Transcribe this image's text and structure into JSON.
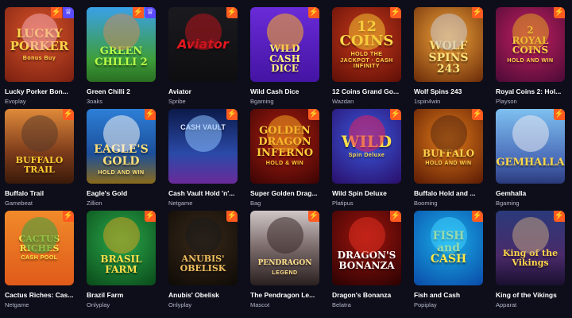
{
  "games": [
    {
      "title": "Lucky Porker Bon...",
      "provider": "Evoplay",
      "art": "LUCKY\nPORKER",
      "art_sub": "Bonus Buy",
      "theme": "t-lucky",
      "figure": "#f6a7b0",
      "badges": [
        "hot",
        "trophy"
      ]
    },
    {
      "title": "Green Chilli 2",
      "provider": "3oaks",
      "art": "GREEN\nCHILLI 2",
      "art_sub": "",
      "theme": "t-chilli",
      "figure": "#c98a5a",
      "badges": [
        "hot",
        "trophy"
      ]
    },
    {
      "title": "Aviator",
      "provider": "Spribe",
      "art": "Aviator",
      "art_sub": "",
      "theme": "t-aviator",
      "figure": "#b8141c",
      "badges": [
        "hot"
      ]
    },
    {
      "title": "Wild Cash Dice",
      "provider": "Bgaming",
      "art": "WILD CASH\nDICE",
      "art_sub": "",
      "theme": "t-wildcash",
      "figure": "#ffb020",
      "badges": [
        "hot"
      ]
    },
    {
      "title": "12 Coins Grand Go...",
      "provider": "Wazdan",
      "art": "12\nCOINS",
      "art_sub": "HOLD THE JACKPOT · CASH INFINITY",
      "theme": "t-coins12",
      "figure": "#f0c030",
      "badges": [
        "hot"
      ]
    },
    {
      "title": "Wolf Spins 243",
      "provider": "1spin4win",
      "art": "WOLF\nSPINS 243",
      "art_sub": "",
      "theme": "t-wolf",
      "figure": "#c8c8d0",
      "badges": [
        "hot"
      ]
    },
    {
      "title": "Royal Coins 2: Hol...",
      "provider": "Playson",
      "art": "2\nROYAL COINS",
      "art_sub": "HOLD AND WIN",
      "theme": "t-royal",
      "figure": "#e0a020",
      "badges": [
        "hot"
      ]
    },
    {
      "title": "Buffalo Trail",
      "provider": "Gamebeat",
      "art": "BUFFALO TRAIL",
      "art_sub": "",
      "theme": "t-buffalo",
      "figure": "#5a3a2a",
      "badges": [
        "hot"
      ]
    },
    {
      "title": "Eagle's Gold",
      "provider": "Zillion",
      "art": "EAGLE'S\nGOLD",
      "art_sub": "HOLD AND WIN",
      "theme": "t-eagle",
      "figure": "#f4f4f4",
      "badges": [
        "hot"
      ]
    },
    {
      "title": "Cash Vault Hold 'n'...",
      "provider": "Netgame",
      "art": "CASH VAULT",
      "art_sub": "",
      "theme": "t-cashvault",
      "figure": "#8ac0ff",
      "badges": [
        "hot"
      ]
    },
    {
      "title": "Super Golden Drag...",
      "provider": "Bag",
      "art": "GOLDEN\nDRAGON\nINFERNO",
      "art_sub": "HOLD & WIN",
      "theme": "t-golden",
      "figure": "#f0a020",
      "badges": [
        "hot"
      ]
    },
    {
      "title": "Wild Spin Deluxe",
      "provider": "Platipus",
      "art": "WILD",
      "art_sub": "Spin Deluxe",
      "theme": "t-wildspin",
      "figure": "#e02060",
      "badges": [
        "hot"
      ]
    },
    {
      "title": "Buffalo Hold and ...",
      "provider": "Booming",
      "art": "BUFFALO",
      "art_sub": "HOLD AND WIN",
      "theme": "t-buffalohw",
      "figure": "#5a2a10",
      "badges": [
        "hot"
      ]
    },
    {
      "title": "Gemhalla",
      "provider": "Bgaming",
      "art": "GEMHALLA",
      "art_sub": "",
      "theme": "t-gemhalla",
      "figure": "#e8e8f0",
      "badges": [
        "hot"
      ]
    },
    {
      "title": "Cactus Riches: Cas...",
      "provider": "Netgame",
      "art": "CACTUS\nRICHES",
      "art_sub": "CASH POOL",
      "theme": "t-cactus",
      "figure": "#3aa040",
      "badges": [
        "hot"
      ]
    },
    {
      "title": "Brazil Farm",
      "provider": "Onlyplay",
      "art": "BRASIL FARM",
      "art_sub": "",
      "theme": "t-brazil",
      "figure": "#d0a020",
      "badges": [
        "hot"
      ]
    },
    {
      "title": "Anubis' Obelisk",
      "provider": "Onlyplay",
      "art": "ANUBIS'\nOBELISK",
      "art_sub": "",
      "theme": "t-anubis",
      "figure": "#1a1a1a",
      "badges": [
        "hot"
      ]
    },
    {
      "title": "The Pendragon Le...",
      "provider": "Mascot",
      "art": "PENDRAGON",
      "art_sub": "LEGEND",
      "theme": "t-pendragon",
      "figure": "#3a2a2a",
      "badges": [
        "hot"
      ]
    },
    {
      "title": "Dragon's Bonanza",
      "provider": "Belatra",
      "art": "DRAGON'S\nBONANZA",
      "art_sub": "",
      "theme": "t-dragons",
      "figure": "#e03020",
      "badges": [
        "hot"
      ]
    },
    {
      "title": "Fish and Cash",
      "provider": "Popiplay",
      "art": "FISH\nand\nCASH",
      "art_sub": "",
      "theme": "t-fish",
      "figure": "#40d0ff",
      "badges": [
        "hot"
      ]
    },
    {
      "title": "King of the Vikings",
      "provider": "Apparat",
      "art": "King of the\nVikings",
      "art_sub": "",
      "theme": "t-vikings",
      "figure": "#c0a080",
      "badges": [
        "hot"
      ]
    }
  ],
  "icons": {
    "hot": "lightning-icon",
    "trophy": "trophy-icon"
  },
  "colors": {
    "background": "#0d0e1a",
    "hot_badge": "#ff5a1f",
    "trophy_badge": "#5b4bff",
    "provider_text": "#b5b7c9"
  }
}
